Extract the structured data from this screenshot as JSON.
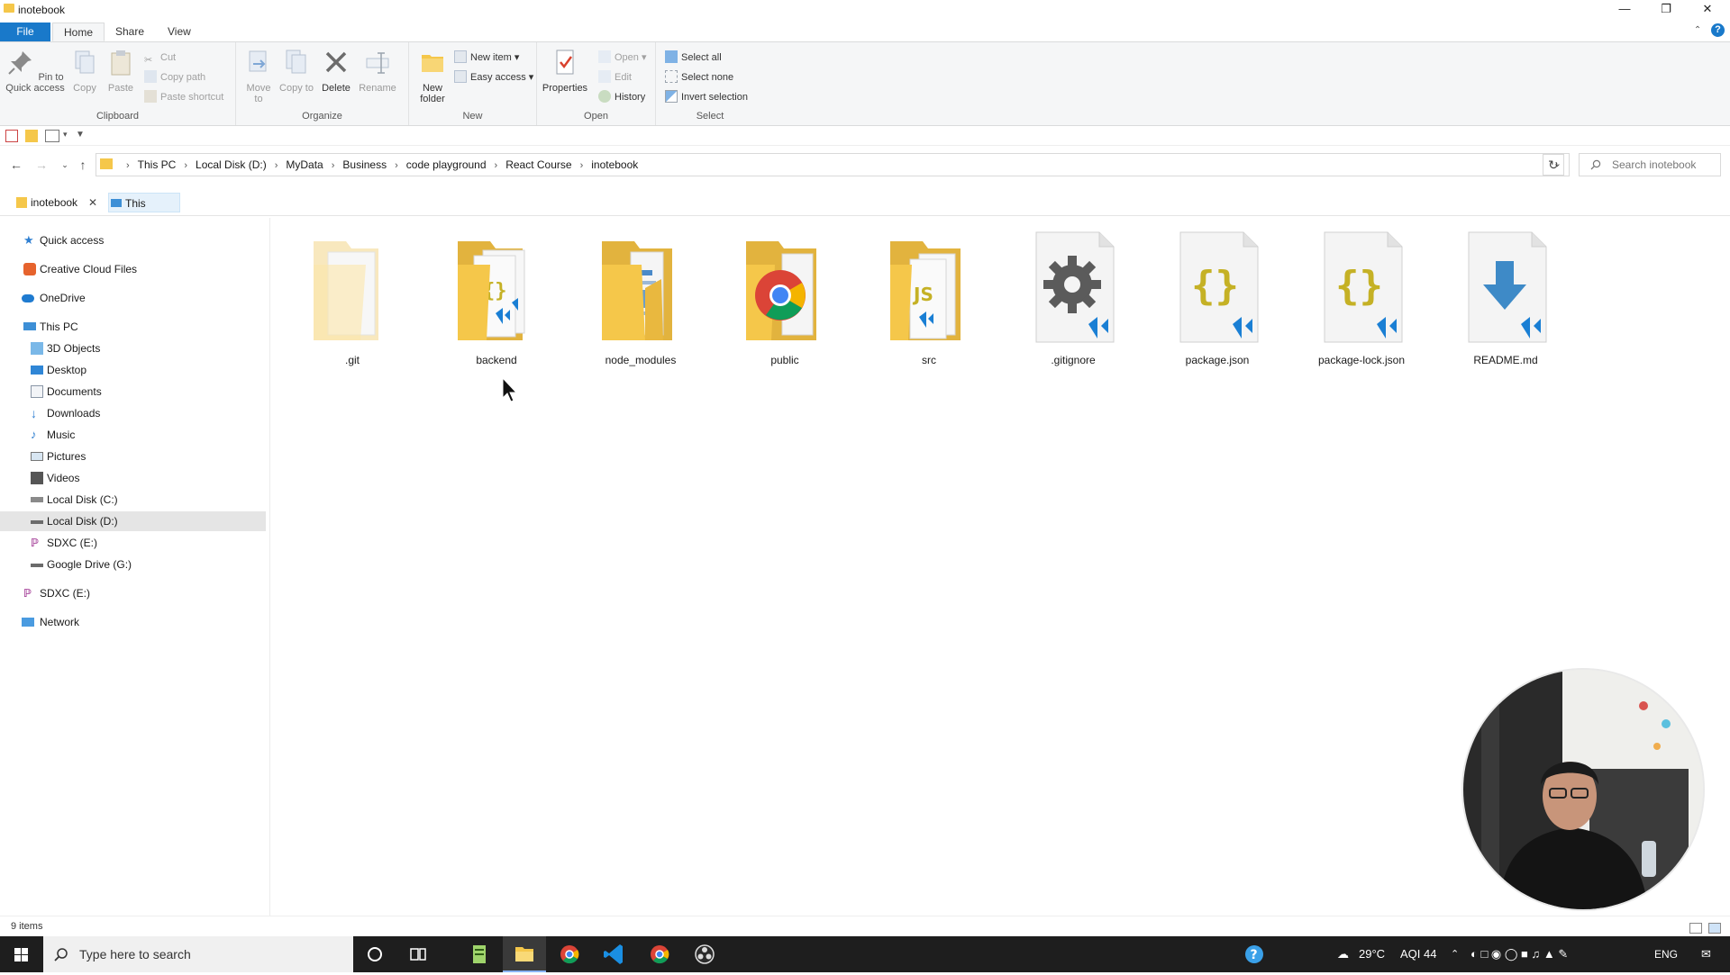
{
  "window": {
    "title": "inotebook"
  },
  "ribbon_tabs": [
    "File",
    "Home",
    "Share",
    "View"
  ],
  "ribbon": {
    "clipboard": {
      "label": "Clipboard",
      "pin": "Pin to Quick access",
      "copy": "Copy",
      "paste": "Paste",
      "cut": "Cut",
      "copy_path": "Copy path",
      "paste_shortcut": "Paste shortcut"
    },
    "organize": {
      "label": "Organize",
      "move_to": "Move to",
      "copy_to": "Copy to",
      "delete": "Delete",
      "rename": "Rename"
    },
    "new": {
      "label": "New",
      "new_folder": "New folder",
      "new_item": "New item",
      "easy_access": "Easy access"
    },
    "open": {
      "label": "Open",
      "properties": "Properties",
      "open": "Open",
      "edit": "Edit",
      "history": "History"
    },
    "select": {
      "label": "Select",
      "select_all": "Select all",
      "select_none": "Select none",
      "invert_selection": "Invert selection"
    }
  },
  "address": {
    "crumbs": [
      "This PC",
      "Local Disk (D:)",
      "MyData",
      "Business",
      "code playground",
      "React Course",
      "inotebook"
    ],
    "search_placeholder": "Search inotebook"
  },
  "tabs": [
    {
      "label": "inotebook",
      "icon": "folder-icon"
    },
    {
      "label": "This PC",
      "icon": "computer-icon"
    }
  ],
  "nav": {
    "quick_access": "Quick access",
    "creative_cloud": "Creative Cloud Files",
    "onedrive": "OneDrive",
    "this_pc": "This PC",
    "objects_3d": "3D Objects",
    "desktop": "Desktop",
    "documents": "Documents",
    "downloads": "Downloads",
    "music": "Music",
    "pictures": "Pictures",
    "videos": "Videos",
    "disk_c": "Local Disk (C:)",
    "disk_d": "Local Disk (D:)",
    "sdxc_e": "SDXC (E:)",
    "gdrive": "Google Drive (G:)",
    "sdxc_e2": "SDXC (E:)",
    "network": "Network"
  },
  "files": [
    {
      "name": ".git",
      "kind": "folder-blank"
    },
    {
      "name": "backend",
      "kind": "folder-code"
    },
    {
      "name": "node_modules",
      "kind": "folder-docs"
    },
    {
      "name": "public",
      "kind": "folder-chrome"
    },
    {
      "name": "src",
      "kind": "folder-js"
    },
    {
      "name": ".gitignore",
      "kind": "file-gear"
    },
    {
      "name": "package.json",
      "kind": "file-json"
    },
    {
      "name": "package-lock.json",
      "kind": "file-json"
    },
    {
      "name": "README.md",
      "kind": "file-md"
    }
  ],
  "status": {
    "items": "9 items"
  },
  "taskbar": {
    "search_placeholder": "Type here to search",
    "weather": "29°C",
    "aqi": "AQI 44",
    "lang": "ENG"
  },
  "colors": {
    "accent": "#1979ca",
    "folder": "#f5c74a",
    "vscode": "#0a78d4",
    "json_brace": "#c5b125",
    "taskbar": "#1e1e1e"
  }
}
